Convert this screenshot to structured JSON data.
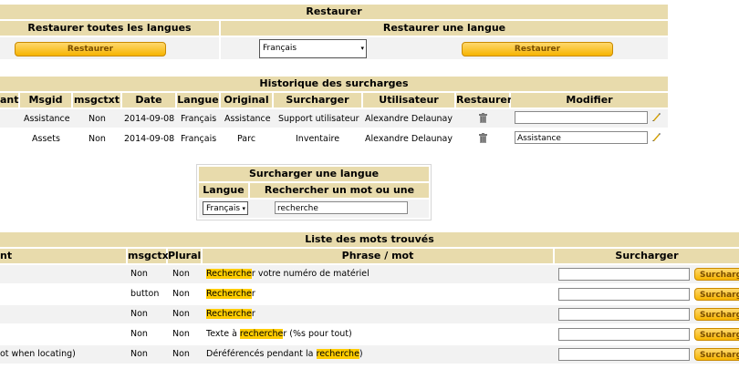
{
  "restore": {
    "title": "Restaurer",
    "all_label": "Restaurer toutes les langues",
    "one_label": "Restaurer une langue",
    "button_label": "Restaurer",
    "lang_value": "Français"
  },
  "history": {
    "title": "Historique des surcharges",
    "columns": [
      "ant",
      "Msgid",
      "msgctxt",
      "Date",
      "Langue",
      "Original",
      "Surcharger",
      "Utilisateur",
      "Restaurer",
      "Modifier"
    ],
    "rows": [
      {
        "msgid": "Assistance",
        "msgctxt": "Non",
        "date": "2014-09-08",
        "langue": "Français",
        "original": "Assistance",
        "surcharger": "Support utilisateur",
        "utilisateur": "Alexandre Delaunay",
        "modifier": ""
      },
      {
        "msgid": "Assets",
        "msgctxt": "Non",
        "date": "2014-09-08",
        "langue": "Français",
        "original": "Parc",
        "surcharger": "Inventaire",
        "utilisateur": "Alexandre Delaunay",
        "modifier": "Assistance"
      }
    ]
  },
  "override": {
    "title": "Surcharger une langue",
    "col_lang": "Langue",
    "col_search": "Rechercher un mot ou une phrase",
    "lang_value": "Français",
    "search_value": "recherche"
  },
  "found": {
    "title": "Liste des mots trouvés",
    "columns": [
      "nt",
      "msgctx",
      "Plural",
      "Phrase / mot",
      "Surcharger"
    ],
    "button_label": "Surcharg",
    "rows": [
      {
        "left": "",
        "msgctx": "Non",
        "plural": "Non",
        "pre": "",
        "hl": "Recherche",
        "post": "r votre numéro de matériel"
      },
      {
        "left": "",
        "msgctx": "button",
        "plural": "Non",
        "pre": "",
        "hl": "Recherche",
        "post": "r"
      },
      {
        "left": "",
        "msgctx": "Non",
        "plural": "Non",
        "pre": "",
        "hl": "Recherche",
        "post": "r"
      },
      {
        "left": "",
        "msgctx": "Non",
        "plural": "Non",
        "pre": "Texte à ",
        "hl": "recherche",
        "post": "r (%s pour tout)"
      },
      {
        "left": "ot when locating)",
        "msgctx": "Non",
        "plural": "Non",
        "pre": "Déréférencés pendant la ",
        "hl": "recherche",
        "post": ")"
      }
    ]
  }
}
